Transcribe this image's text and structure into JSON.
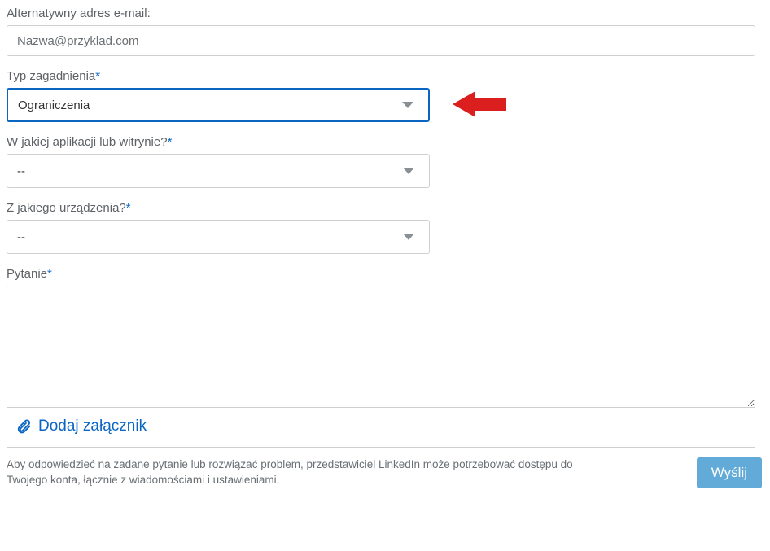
{
  "alt_email": {
    "label": "Alternatywny adres e-mail:",
    "placeholder": "Nazwa@przyklad.com"
  },
  "issue_type": {
    "label": "Typ zagadnienia",
    "required": "*",
    "value": "Ograniczenia"
  },
  "app_or_site": {
    "label": "W jakiej aplikacji lub witrynie?",
    "required": "*",
    "value": "--"
  },
  "device": {
    "label": "Z jakiego urządzenia?",
    "required": "*",
    "value": "--"
  },
  "question": {
    "label": "Pytanie",
    "required": "*"
  },
  "attach": {
    "label": "Dodaj załącznik"
  },
  "footer": {
    "text": "Aby odpowiedzieć na zadane pytanie lub rozwiązać problem, przedstawiciel LinkedIn może potrzebować dostępu do Twojego konta, łącznie z wiadomościami i ustawieniami."
  },
  "submit": {
    "label": "Wyślij"
  }
}
